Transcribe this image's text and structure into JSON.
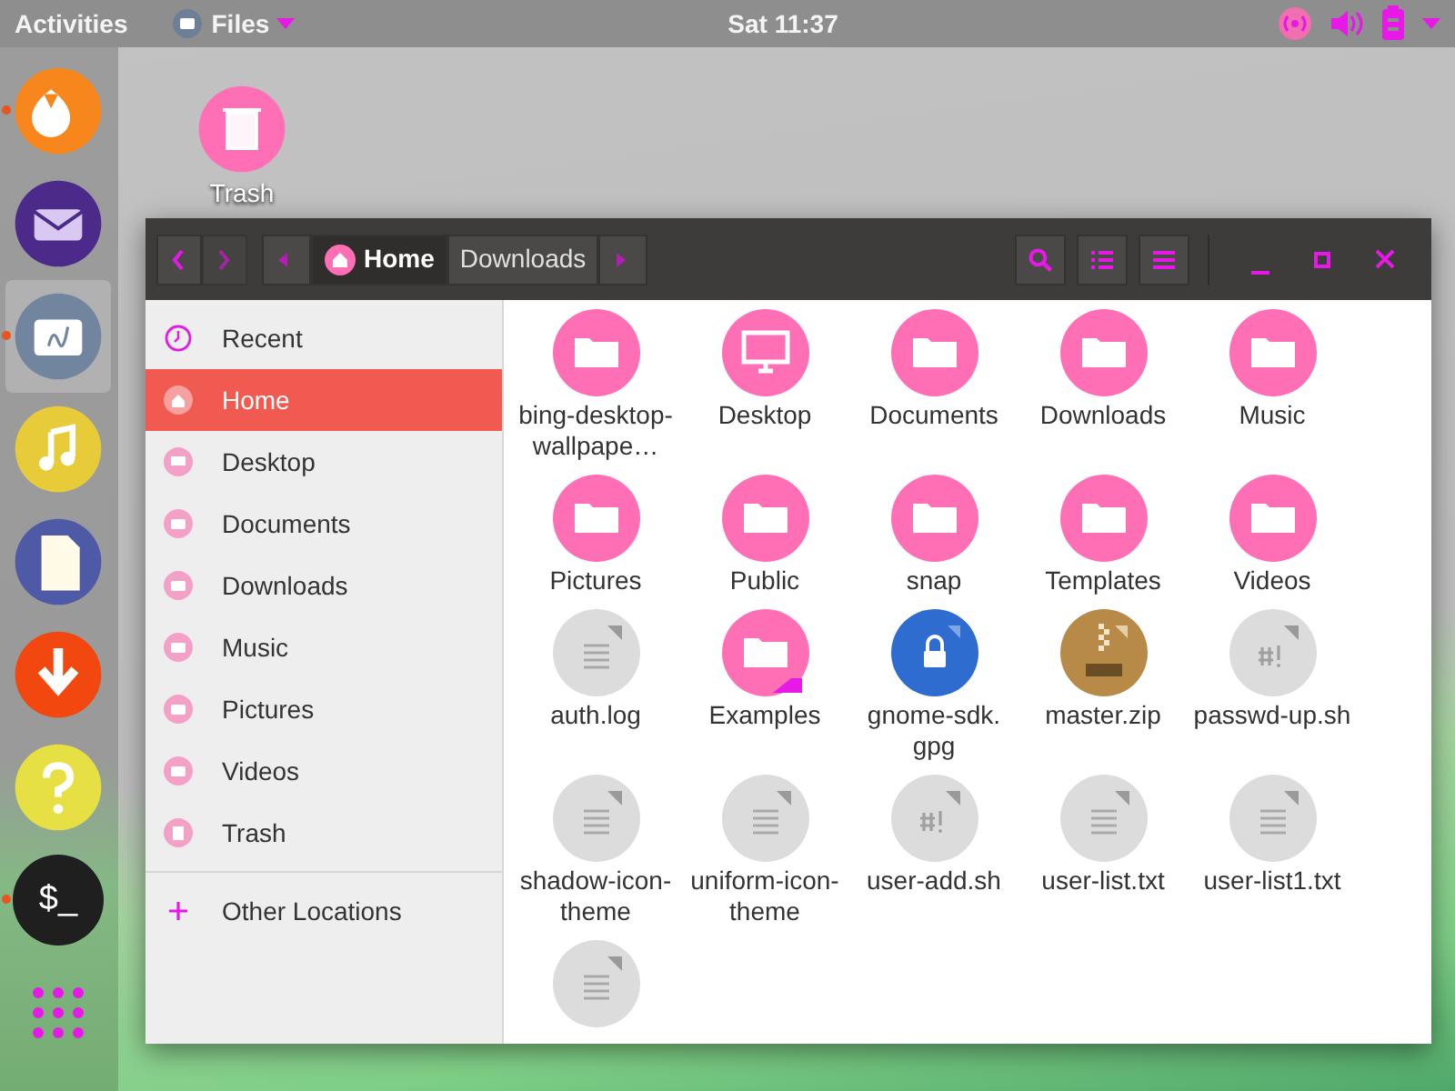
{
  "top_bar": {
    "activities": "Activities",
    "app_menu": "Files",
    "clock": "Sat 11:37"
  },
  "dock": [
    {
      "kind": "flame",
      "running": true,
      "selected": false
    },
    {
      "kind": "mail",
      "running": false,
      "selected": false
    },
    {
      "kind": "files",
      "running": true,
      "selected": true
    },
    {
      "kind": "music",
      "running": false,
      "selected": false
    },
    {
      "kind": "document",
      "running": false,
      "selected": false
    },
    {
      "kind": "download",
      "running": false,
      "selected": false
    },
    {
      "kind": "help",
      "running": false,
      "selected": false
    },
    {
      "kind": "terminal",
      "running": true,
      "selected": false,
      "glyph": "$_"
    },
    {
      "kind": "apps",
      "running": false,
      "selected": false
    }
  ],
  "desktop_icons": [
    {
      "label": "Trash"
    }
  ],
  "window": {
    "path": [
      {
        "label": "Home",
        "kind": "home",
        "selected": true
      },
      {
        "label": "Downloads",
        "kind": "folder",
        "selected": false
      }
    ],
    "sidebar": {
      "items": [
        {
          "label": "Recent",
          "kind": "recent",
          "selected": false
        },
        {
          "label": "Home",
          "kind": "home",
          "selected": true
        },
        {
          "label": "Desktop",
          "kind": "desktop",
          "selected": false
        },
        {
          "label": "Documents",
          "kind": "folder",
          "selected": false
        },
        {
          "label": "Downloads",
          "kind": "folder",
          "selected": false
        },
        {
          "label": "Music",
          "kind": "folder",
          "selected": false
        },
        {
          "label": "Pictures",
          "kind": "folder",
          "selected": false
        },
        {
          "label": "Videos",
          "kind": "folder",
          "selected": false
        },
        {
          "label": "Trash",
          "kind": "trash",
          "selected": false
        }
      ],
      "other": {
        "label": "Other Locations"
      }
    },
    "files": [
      {
        "label": "bing-desktop-wallpape…",
        "kind": "folder"
      },
      {
        "label": "Desktop",
        "kind": "desktop"
      },
      {
        "label": "Documents",
        "kind": "folder"
      },
      {
        "label": "Downloads",
        "kind": "folder"
      },
      {
        "label": "Music",
        "kind": "folder"
      },
      {
        "label": "Pictures",
        "kind": "folder"
      },
      {
        "label": "Public",
        "kind": "folder"
      },
      {
        "label": "snap",
        "kind": "folder"
      },
      {
        "label": "Templates",
        "kind": "folder"
      },
      {
        "label": "Videos",
        "kind": "folder"
      },
      {
        "label": "auth.log",
        "kind": "text"
      },
      {
        "label": "Examples",
        "kind": "link"
      },
      {
        "label": "gnome-sdk.gpg",
        "kind": "lock"
      },
      {
        "label": "master.zip",
        "kind": "zip"
      },
      {
        "label": "passwd-up.sh",
        "kind": "script"
      },
      {
        "label": "shadow-icon-theme",
        "kind": "text"
      },
      {
        "label": "uniform-icon-theme",
        "kind": "text"
      },
      {
        "label": "user-add.sh",
        "kind": "script"
      },
      {
        "label": "user-list.txt",
        "kind": "text"
      },
      {
        "label": "user-list1.txt",
        "kind": "text"
      },
      {
        "kind": "text"
      }
    ]
  }
}
